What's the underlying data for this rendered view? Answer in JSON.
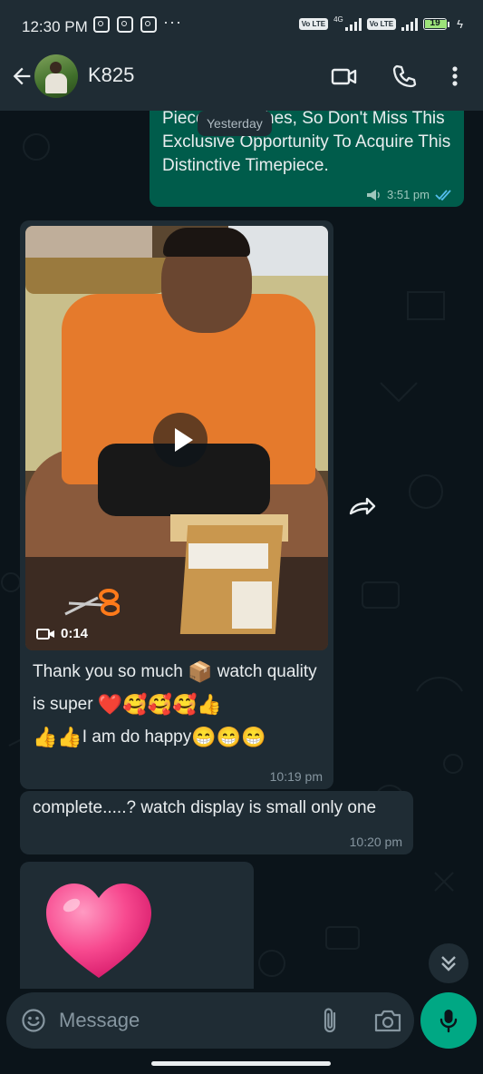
{
  "status_bar": {
    "time": "12:30 PM",
    "network_label": "4G",
    "volte_label": "Vo LTE",
    "volte_label_2": "Vo LTE",
    "battery_level": "19"
  },
  "header": {
    "contact_name": "K825",
    "icons": [
      "back-arrow-icon",
      "avatar",
      "video-call-icon",
      "phone-call-icon",
      "more-vertical-icon"
    ]
  },
  "chat": {
    "date_divider": "Yesterday",
    "outgoing": {
      "text": "Piece of watches, So Don't Miss This Exclusive Opportunity To Acquire This Distinctive Timepiece.",
      "time": "3:51 pm",
      "status": "read"
    },
    "video_message": {
      "duration": "0:14",
      "caption_part1": "Thank you so much ",
      "caption_part2": " watch quality is super ",
      "caption_part3": "I am do happy",
      "emoji_box": "📦",
      "emoji_heart": "❤️",
      "emoji_smile_hearts": "🥰🥰🥰",
      "emoji_thumbs_a": "👍",
      "emoji_thumbs_b": "👍👍",
      "emoji_grin": "😁😁😁",
      "time": "10:19 pm"
    },
    "text_message": {
      "text": "complete.....? watch display is small only one",
      "time": "10:20 pm"
    },
    "sticker_message": {
      "emoji": "heart"
    }
  },
  "composer": {
    "placeholder": "Message"
  },
  "colors": {
    "background": "#0b141a",
    "incoming_bubble": "#1f2c34",
    "outgoing_bubble": "#005c4b",
    "accent": "#00a884",
    "read_ticks": "#53bdeb"
  }
}
